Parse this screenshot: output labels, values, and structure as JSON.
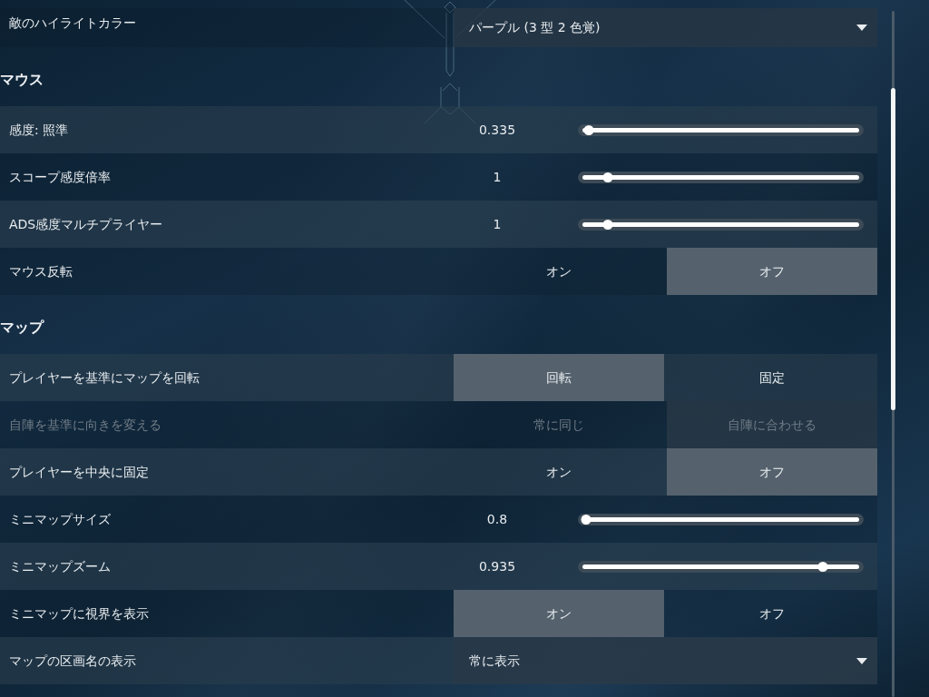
{
  "sections": [
    {
      "settings": [
        {
          "kind": "dropdown",
          "label": "敵のハイライトカラー",
          "value": "パープル (3 型 2 色覚)",
          "shaded": false,
          "disabled": false
        }
      ]
    },
    {
      "title": "マウス",
      "settings": [
        {
          "kind": "slider",
          "label": "感度: 照準",
          "reading": "0.335",
          "level": 0.01,
          "shaded": true,
          "disabled": false
        },
        {
          "kind": "slider",
          "label": "スコープ感度倍率",
          "reading": "1",
          "level": 0.08,
          "shaded": false,
          "disabled": false
        },
        {
          "kind": "slider",
          "label": "ADS感度マルチプライヤー",
          "reading": "1",
          "level": 0.08,
          "shaded": true,
          "disabled": false
        },
        {
          "kind": "toggle",
          "label": "マウス反転",
          "shaded": false,
          "disabled": false,
          "options": [
            {
              "label": "オン",
              "selected": false
            },
            {
              "label": "オフ",
              "selected": true
            }
          ]
        }
      ]
    },
    {
      "title": "マップ",
      "settings": [
        {
          "kind": "toggle",
          "label": "プレイヤーを基準にマップを回転",
          "shaded": true,
          "disabled": false,
          "options": [
            {
              "label": "回転",
              "selected": true
            },
            {
              "label": "固定",
              "selected": false
            }
          ]
        },
        {
          "kind": "toggle",
          "label": "自陣を基準に向きを変える",
          "shaded": false,
          "disabled": true,
          "options": [
            {
              "label": "常に同じ",
              "selected": false
            },
            {
              "label": "自陣に合わせる",
              "selected": true
            }
          ]
        },
        {
          "kind": "toggle",
          "label": "プレイヤーを中央に固定",
          "shaded": true,
          "disabled": false,
          "options": [
            {
              "label": "オン",
              "selected": false
            },
            {
              "label": "オフ",
              "selected": true
            }
          ]
        },
        {
          "kind": "slider",
          "label": "ミニマップサイズ",
          "reading": "0.8",
          "level": 0.0,
          "shaded": false,
          "disabled": false
        },
        {
          "kind": "slider",
          "label": "ミニマップズーム",
          "reading": "0.935",
          "level": 0.88,
          "shaded": true,
          "disabled": false
        },
        {
          "kind": "toggle",
          "label": "ミニマップに視界を表示",
          "shaded": false,
          "disabled": false,
          "options": [
            {
              "label": "オン",
              "selected": true
            },
            {
              "label": "オフ",
              "selected": false
            }
          ]
        },
        {
          "kind": "dropdown",
          "label": "マップの区画名の表示",
          "value": "常に表示",
          "shaded": true,
          "disabled": false
        }
      ]
    }
  ]
}
